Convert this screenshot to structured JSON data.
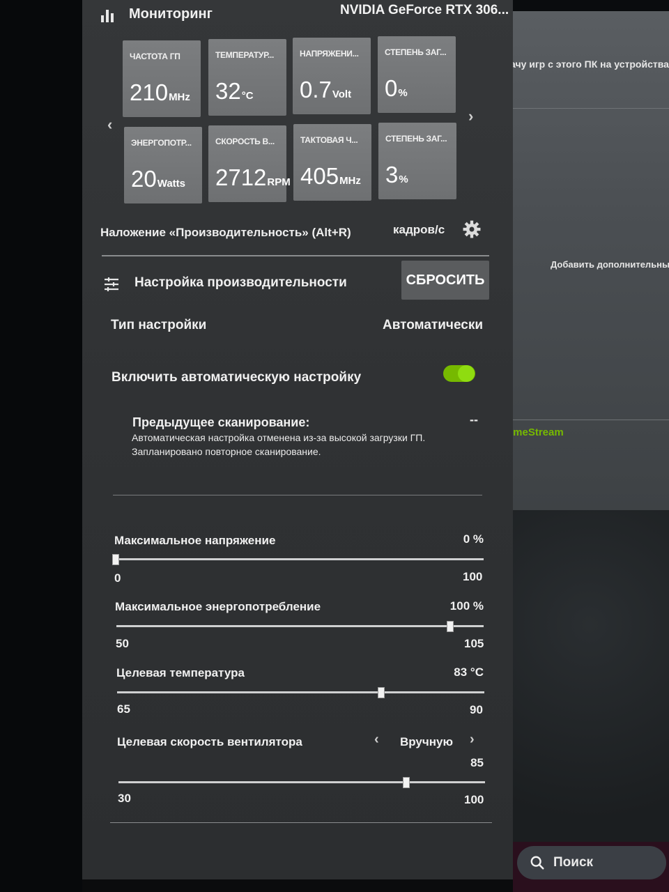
{
  "header": {
    "title": "Мониторинг",
    "gpu_name": "NVIDIA GeForce RTX 306...",
    "icon": "bar-chart-icon"
  },
  "tiles": [
    {
      "label": "ЧАСТОТА ГП",
      "value": "210",
      "unit": "MHz"
    },
    {
      "label": "ТЕМПЕРАТУР...",
      "value": "32",
      "unit": "°C"
    },
    {
      "label": "НАПРЯЖЕНИ...",
      "value": "0.7",
      "unit": "Volt"
    },
    {
      "label": "СТЕПЕНЬ ЗАГ...",
      "value": "0",
      "unit": "%"
    },
    {
      "label": "ЭНЕРГОПОТР...",
      "value": "20",
      "unit": "Watts"
    },
    {
      "label": "СКОРОСТЬ В...",
      "value": "2712",
      "unit": "RPM"
    },
    {
      "label": "ТАКТОВАЯ Ч...",
      "value": "405",
      "unit": "MHz"
    },
    {
      "label": "СТЕПЕНЬ ЗАГ...",
      "value": "3",
      "unit": "%"
    }
  ],
  "overlay": {
    "label": "Наложение «Производительность» (Alt+R)",
    "value": "кадров/с"
  },
  "tuning": {
    "title": "Настройка производительности",
    "reset_label": "СБРОСИТЬ",
    "type_label": "Тип настройки",
    "type_value": "Автоматически",
    "auto_label": "Включить автоматическую настройку",
    "auto_enabled": true,
    "scan_title": "Предыдущее сканирование:",
    "scan_dash": "--",
    "scan_line1": "Автоматическая настройка отменена из-за высокой загрузки ГП.",
    "scan_line2": "Запланировано повторное сканирование."
  },
  "sliders": [
    {
      "title": "Максимальное напряжение",
      "value_text": "0 %",
      "min": "0",
      "max": "100",
      "value": 0,
      "lo": 0,
      "hi": 100
    },
    {
      "title": "Максимальное энергопотребление",
      "value_text": "100 %",
      "min": "50",
      "max": "105",
      "value": 100,
      "lo": 50,
      "hi": 105
    },
    {
      "title": "Целевая температура",
      "value_text": "83 °C",
      "min": "65",
      "max": "90",
      "value": 83,
      "lo": 65,
      "hi": 90
    },
    {
      "title": "Целевая скорость вентилятора",
      "mode": "Вручную",
      "value_text": "85",
      "min": "30",
      "max": "100",
      "value": 85,
      "lo": 30,
      "hi": 100
    }
  ],
  "background": {
    "text_top": "ачу игр с этого ПК на устройства SH",
    "text_mid": "Добавить дополнительны",
    "link": "imeStream",
    "search_label": "Поиск"
  },
  "colors": {
    "accent": "#76b900",
    "panel": "#333537",
    "tile": "#75777a"
  }
}
